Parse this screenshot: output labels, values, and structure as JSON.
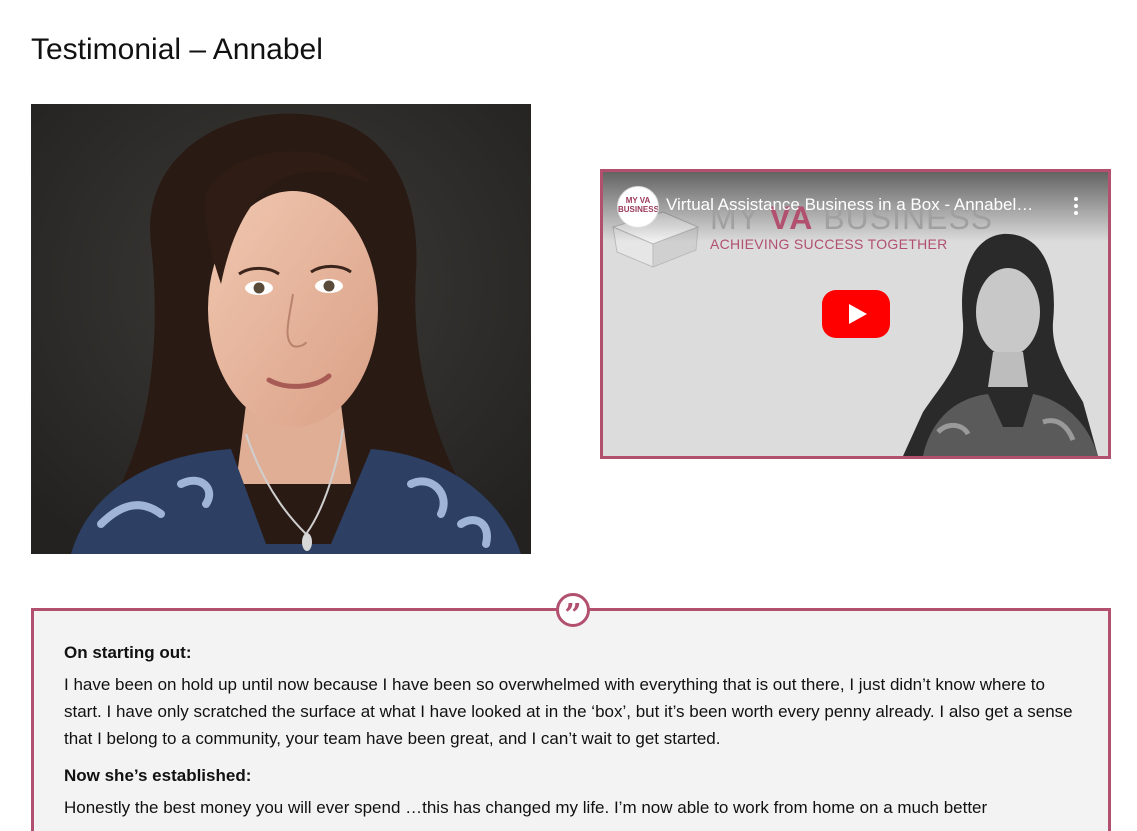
{
  "page": {
    "title": "Testimonial – Annabel"
  },
  "video": {
    "title": "Virtual Assistance Business in a Box - Annabel…",
    "channel_logo_text": "MY VA BUSINESS",
    "brand_prefix": "MY ",
    "brand_highlight": "VA",
    "brand_suffix": " BUSINESS",
    "brand_tagline": "ACHIEVING SUCCESS TOGETHER",
    "play_icon": "youtube-play-icon",
    "menu_icon": "more-vertical-icon"
  },
  "testimonial": {
    "quote_icon": "quote-icon",
    "sections": [
      {
        "heading": "On starting out:",
        "text": "I have been on hold up until now because I have been so overwhelmed with everything that is out there, I just didn’t know where to start. I have only scratched the surface at what I have looked at in the ‘box’, but it’s been worth every penny already. I also get a sense that I belong to a community, your team have been great, and I can’t wait to get started."
      },
      {
        "heading": "Now she’s established:",
        "text": "Honestly the best money you will ever spend …this has changed my life. I’m now able to work from home on a much better"
      }
    ]
  },
  "colors": {
    "accent": "#b1506f",
    "quote_bg": "#f4f3f3",
    "play_red": "#ff0000"
  }
}
